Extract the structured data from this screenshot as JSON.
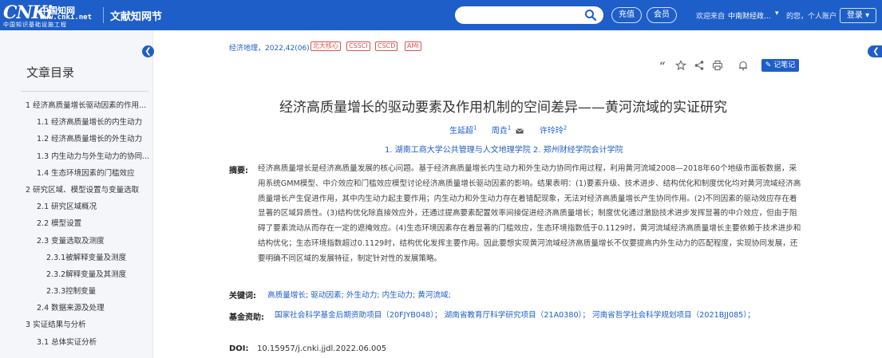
{
  "header": {
    "logo_mark": "CNKi",
    "logo_cn": "中国知网",
    "logo_url": "www.cnki.net",
    "logo_sub": "中国知识基础设施工程",
    "site_name": "文献知网节",
    "search_placeholder": "",
    "recharge": "充值",
    "member": "会员",
    "welcome": "欢迎来自",
    "org": "中南财经政...",
    "hello": "的您，个人账户",
    "login": "登录",
    "brand_color": "#1e5ec8"
  },
  "sidebar": {
    "title": "文章目录",
    "items": [
      {
        "label": "1 经济高质量增长驱动因素的作用...",
        "level": 1
      },
      {
        "label": "1.1 经济高质量增长的内生动力",
        "level": 2
      },
      {
        "label": "1.2 经济高质量增长的外生动力",
        "level": 2
      },
      {
        "label": "1.3 内生动力与外生动力的协同...",
        "level": 2
      },
      {
        "label": "1.4 生态环境因素的门槛效应",
        "level": 2
      },
      {
        "label": "2 研究区域、模型设置与变量选取",
        "level": 1
      },
      {
        "label": "2.1 研究区域概况",
        "level": 2
      },
      {
        "label": "2.2 模型设置",
        "level": 2
      },
      {
        "label": "2.3 变量选取及测度",
        "level": 2
      },
      {
        "label": "2.3.1被解释变量及测度",
        "level": 3
      },
      {
        "label": "2.3.2解释变量及其测度",
        "level": 3
      },
      {
        "label": "2.3.3控制变量",
        "level": 3
      },
      {
        "label": "2.4 数据来源及处理",
        "level": 2
      },
      {
        "label": "3 实证结果与分析",
        "level": 1
      },
      {
        "label": "3.1 总体实证分析",
        "level": 2
      }
    ]
  },
  "article": {
    "source": "经济地理，2022,42(06)",
    "tags": [
      "北大核心",
      "CSSCI",
      "CSCD",
      "AMI"
    ],
    "note_button": "记笔记",
    "title": "经济高质量增长的驱动要素及作用机制的空间差异——黄河流域的实证研究",
    "authors": [
      {
        "name": "生延超",
        "sup": "1"
      },
      {
        "name": "周垚",
        "sup": "1"
      },
      {
        "name": "许玲玲",
        "sup": "2"
      }
    ],
    "affiliations": "1. 湖南工商大学公共管理与人文地理学院  2. 郑州财经学院会计学院",
    "abstract_label": "摘要:",
    "abstract": "经济高质量增长是经济高质量发展的核心问题。基于经济高质量增长内生动力和外生动力协同作用过程，利用黄河流域2008—2018年60个地级市面板数据，采用系统GMM模型、中介效应和门槛效应模型讨论经济高质量增长驱动因素的影响。结果表明：(1)要素升级、技术进步、结构优化和制度优化均对黄河流域经济高质量增长产生促进作用，其中内生动力起主要作用；内生动力和外生动力存在着错配现象，无法对经济高质量增长产生协同作用。(2)不同因素的驱动效应存在着显著的区域异质性。(3)结构优化除直接效应外，还通过提高要素配置效率间接促进经济高质量增长；制度优化通过激励技术进步发挥显著的中介效应，但由于阻碍了要素流动从而存在一定的遮掩效应。(4)生态环境因素存在着显著的门槛效应，生态环境指数低于0.1129时，黄河流域经济高质量增长主要依赖于技术进步和结构优化；生态环境指数超过0.1129时，结构优化发挥主要作用。因此要想实现黄河流域经济高质量增长不仅要提高内外生动力的匹配程度，实现协同发展，还要明确不同区域的发展特征，制定针对性的发展策略。",
    "keywords_label": "关键词:",
    "keywords": "高质量增长;  驱动因素;  外生动力;  内生动力;  黄河流域;",
    "fund_label": "基金资助:",
    "fund": "国家社会科学基金后期资助项目（20FJYB048）；  湖南省教育厅科学研究项目（21A0380）；  河南省哲学社会科学规划项目（2021BJJ085）；",
    "doi_label": "DOI:",
    "doi": "10.15957/j.cnki.jjdl.2022.06.005"
  },
  "icons": [
    "quote-icon",
    "star-icon",
    "share-icon",
    "print-icon",
    "bell-icon",
    "edit-icon",
    "search-icon",
    "mail-icon"
  ]
}
